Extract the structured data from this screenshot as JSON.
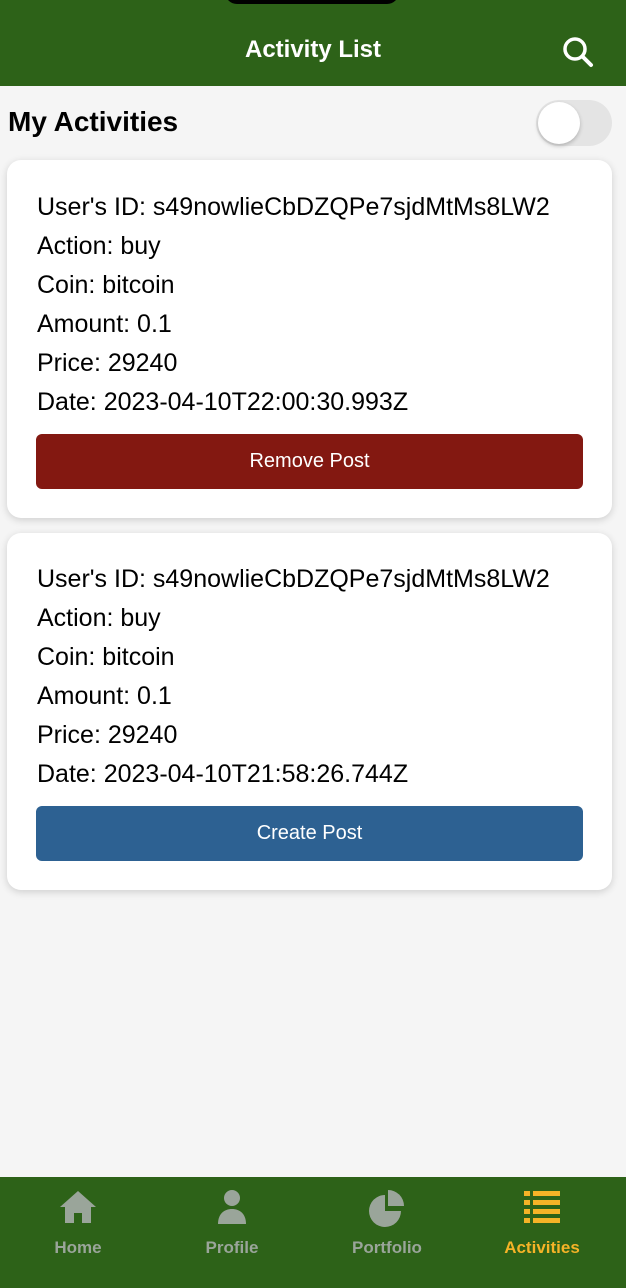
{
  "header": {
    "title": "Activity List",
    "background": "#2d6218"
  },
  "section": {
    "title": "My Activities",
    "toggle_on": false
  },
  "cards": [
    {
      "user_id": "User's ID: s49nowlieCbDZQPe7sjdMtMs8LW2",
      "action": "Action: buy",
      "coin": "Coin: bitcoin",
      "amount": "Amount: 0.1",
      "price": "Price: 29240",
      "date": "Date: 2023-04-10T22:00:30.993Z",
      "button_label": "Remove Post",
      "button_color": "#831811"
    },
    {
      "user_id": "User's ID: s49nowlieCbDZQPe7sjdMtMs8LW2",
      "action": "Action: buy",
      "coin": "Coin: bitcoin",
      "amount": "Amount: 0.1",
      "price": "Price: 29240",
      "date": "Date: 2023-04-10T21:58:26.744Z",
      "button_label": "Create Post",
      "button_color": "#2d6192"
    }
  ],
  "tabs": [
    {
      "label": "Home",
      "icon": "home-icon",
      "active": false
    },
    {
      "label": "Profile",
      "icon": "person-icon",
      "active": false
    },
    {
      "label": "Portfolio",
      "icon": "pie-chart-icon",
      "active": false
    },
    {
      "label": "Activities",
      "icon": "list-icon",
      "active": true
    }
  ],
  "colors": {
    "tab_inactive": "#9aa59a",
    "tab_active": "#f5b327"
  }
}
